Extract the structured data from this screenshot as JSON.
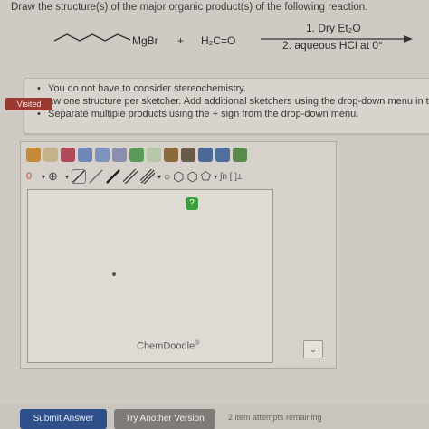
{
  "question": {
    "text": "Draw the structure(s) of the major organic product(s) of the following reaction."
  },
  "reaction": {
    "reagent_1": "MgBr",
    "plus": "+",
    "reagent_2": "H₂C=O",
    "condition_1": "1. Dry Et₂O",
    "condition_2": "2. aqueous HCl at 0°"
  },
  "instructions": {
    "badge": "Visited",
    "items": [
      "You do not have to consider stereochemistry.",
      "aw one structure per sketcher. Add additional sketchers using the drop-down menu in the",
      "Separate multiple products using the + sign from the drop-down menu."
    ]
  },
  "sketcher": {
    "help_badge": "?",
    "brand": "ChemDoodle",
    "registered": "®",
    "dropdown_glyph": "⌄",
    "toolbar": {
      "charge_label": "0",
      "plus_label": "⊕",
      "text_label": "ʃn [ ]±"
    }
  },
  "actions": {
    "submit": "Submit Answer",
    "try_another": "Try Another Version",
    "attempts": "2 item attempts remaining"
  },
  "colors": {
    "visited_badge": "#9b3a33",
    "submit_button": "#2f4f8a",
    "help_badge": "#3f9e3c"
  }
}
